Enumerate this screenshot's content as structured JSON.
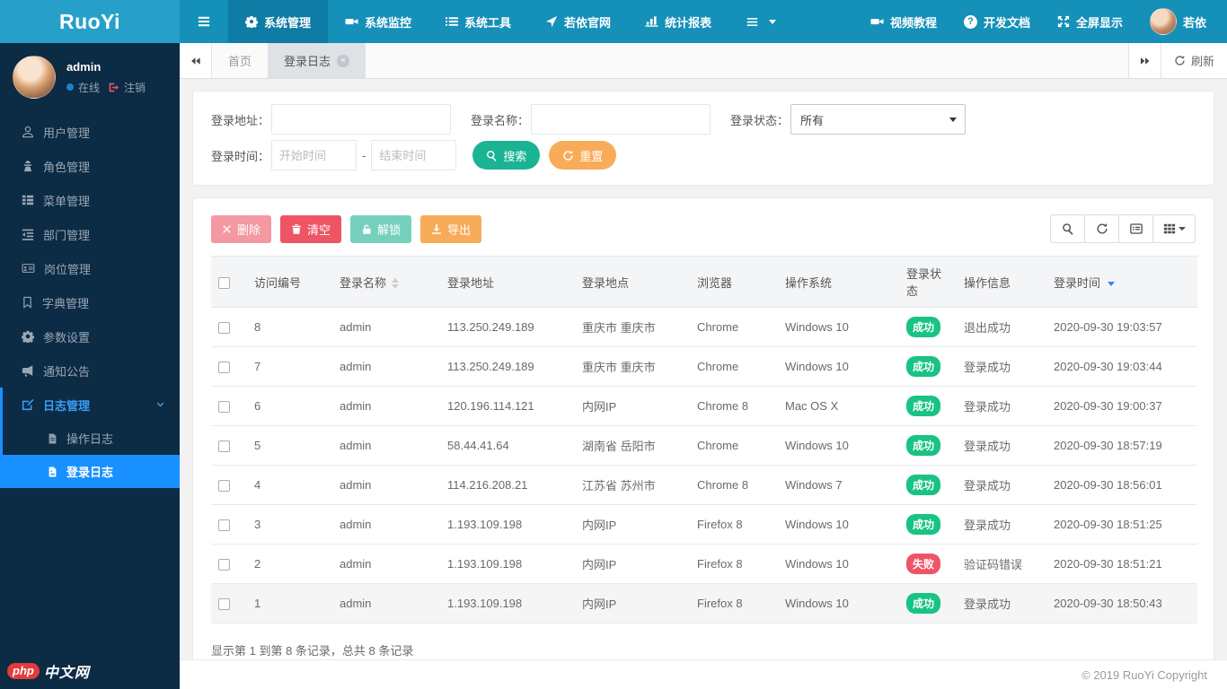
{
  "brand": {
    "logo": "RuoYi",
    "top_username": "若依"
  },
  "topnav": {
    "menu": [
      {
        "label": "系统管理",
        "active": true
      },
      {
        "label": "系统监控",
        "active": false
      },
      {
        "label": "系统工具",
        "active": false
      },
      {
        "label": "若依官网",
        "active": false
      },
      {
        "label": "统计报表",
        "active": false
      }
    ],
    "right": [
      {
        "label": "视频教程"
      },
      {
        "label": "开发文档"
      },
      {
        "label": "全屏显示"
      }
    ]
  },
  "sidebar": {
    "user": {
      "name": "admin",
      "status": "在线",
      "logout": "注销"
    },
    "menu": [
      {
        "label": "用户管理"
      },
      {
        "label": "角色管理"
      },
      {
        "label": "菜单管理"
      },
      {
        "label": "部门管理"
      },
      {
        "label": "岗位管理"
      },
      {
        "label": "字典管理"
      },
      {
        "label": "参数设置"
      },
      {
        "label": "通知公告"
      },
      {
        "label": "日志管理"
      }
    ],
    "submenu": [
      {
        "label": "操作日志",
        "active": false
      },
      {
        "label": "登录日志",
        "active": true
      }
    ]
  },
  "tabs": {
    "home": "首页",
    "active": "登录日志",
    "refresh": "刷新"
  },
  "search": {
    "addr_label": "登录地址：",
    "name_label": "登录名称：",
    "status_label": "登录状态：",
    "status_value": "所有",
    "time_label": "登录时间：",
    "start_placeholder": "开始时间",
    "end_placeholder": "结束时间",
    "dash": "-",
    "search_btn": "搜索",
    "reset_btn": "重置"
  },
  "toolbar": {
    "delete": "删除",
    "clear": "清空",
    "unlock": "解锁",
    "export": "导出"
  },
  "table": {
    "columns": [
      "访问编号",
      "登录名称",
      "登录地址",
      "登录地点",
      "浏览器",
      "操作系统",
      "登录状态",
      "操作信息",
      "登录时间"
    ],
    "rows": [
      {
        "id": "8",
        "name": "admin",
        "ip": "113.250.249.189",
        "location": "重庆市 重庆市",
        "browser": "Chrome",
        "os": "Windows 10",
        "status": "成功",
        "status_type": "success",
        "message": "退出成功",
        "time": "2020-09-30 19:03:57"
      },
      {
        "id": "7",
        "name": "admin",
        "ip": "113.250.249.189",
        "location": "重庆市 重庆市",
        "browser": "Chrome",
        "os": "Windows 10",
        "status": "成功",
        "status_type": "success",
        "message": "登录成功",
        "time": "2020-09-30 19:03:44"
      },
      {
        "id": "6",
        "name": "admin",
        "ip": "120.196.114.121",
        "location": "内网IP",
        "browser": "Chrome 8",
        "os": "Mac OS X",
        "status": "成功",
        "status_type": "success",
        "message": "登录成功",
        "time": "2020-09-30 19:00:37"
      },
      {
        "id": "5",
        "name": "admin",
        "ip": "58.44.41.64",
        "location": "湖南省 岳阳市",
        "browser": "Chrome",
        "os": "Windows 10",
        "status": "成功",
        "status_type": "success",
        "message": "登录成功",
        "time": "2020-09-30 18:57:19"
      },
      {
        "id": "4",
        "name": "admin",
        "ip": "114.216.208.21",
        "location": "江苏省 苏州市",
        "browser": "Chrome 8",
        "os": "Windows 7",
        "status": "成功",
        "status_type": "success",
        "message": "登录成功",
        "time": "2020-09-30 18:56:01"
      },
      {
        "id": "3",
        "name": "admin",
        "ip": "1.193.109.198",
        "location": "内网IP",
        "browser": "Firefox 8",
        "os": "Windows 10",
        "status": "成功",
        "status_type": "success",
        "message": "登录成功",
        "time": "2020-09-30 18:51:25"
      },
      {
        "id": "2",
        "name": "admin",
        "ip": "1.193.109.198",
        "location": "内网IP",
        "browser": "Firefox 8",
        "os": "Windows 10",
        "status": "失败",
        "status_type": "danger",
        "message": "验证码错误",
        "time": "2020-09-30 18:51:21"
      },
      {
        "id": "1",
        "name": "admin",
        "ip": "1.193.109.198",
        "location": "内网IP",
        "browser": "Firefox 8",
        "os": "Windows 10",
        "status": "成功",
        "status_type": "success",
        "message": "登录成功",
        "time": "2020-09-30 18:50:43"
      }
    ]
  },
  "summary": "显示第 1 到第 8 条记录，总共 8 条记录",
  "footer": {
    "copyright": "© 2019 RuoYi Copyright",
    "watermark_badge": "php",
    "watermark_text": "中文网"
  },
  "colors": {
    "header": "#1590b8",
    "sidebar": "#0c2b45",
    "accent": "#1890ff",
    "success": "#18c383",
    "danger": "#ed5565",
    "warning": "#f8ac59",
    "primary_btn": "#1ab394"
  }
}
